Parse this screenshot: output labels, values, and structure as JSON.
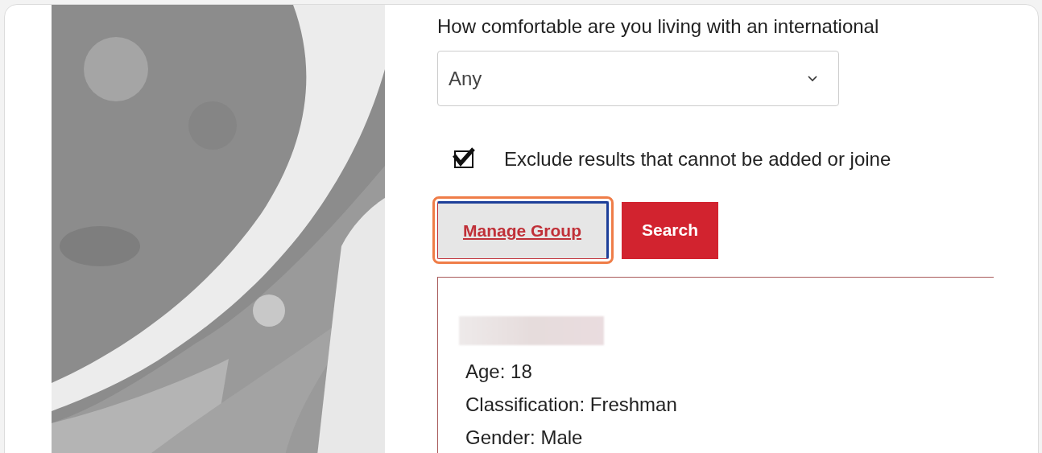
{
  "question": {
    "label": "How comfortable are you living with an international"
  },
  "select": {
    "value": "Any"
  },
  "exclude": {
    "label": "Exclude results that cannot be added or joine",
    "checked": true
  },
  "buttons": [
    {
      "label": "Manage Group",
      "kind": "secondary",
      "focused": true
    },
    {
      "label": "Search",
      "kind": "primary",
      "focused": false
    }
  ],
  "result": {
    "details": [
      "Age: 18",
      "Classification: Freshman",
      "Gender: Male"
    ]
  }
}
